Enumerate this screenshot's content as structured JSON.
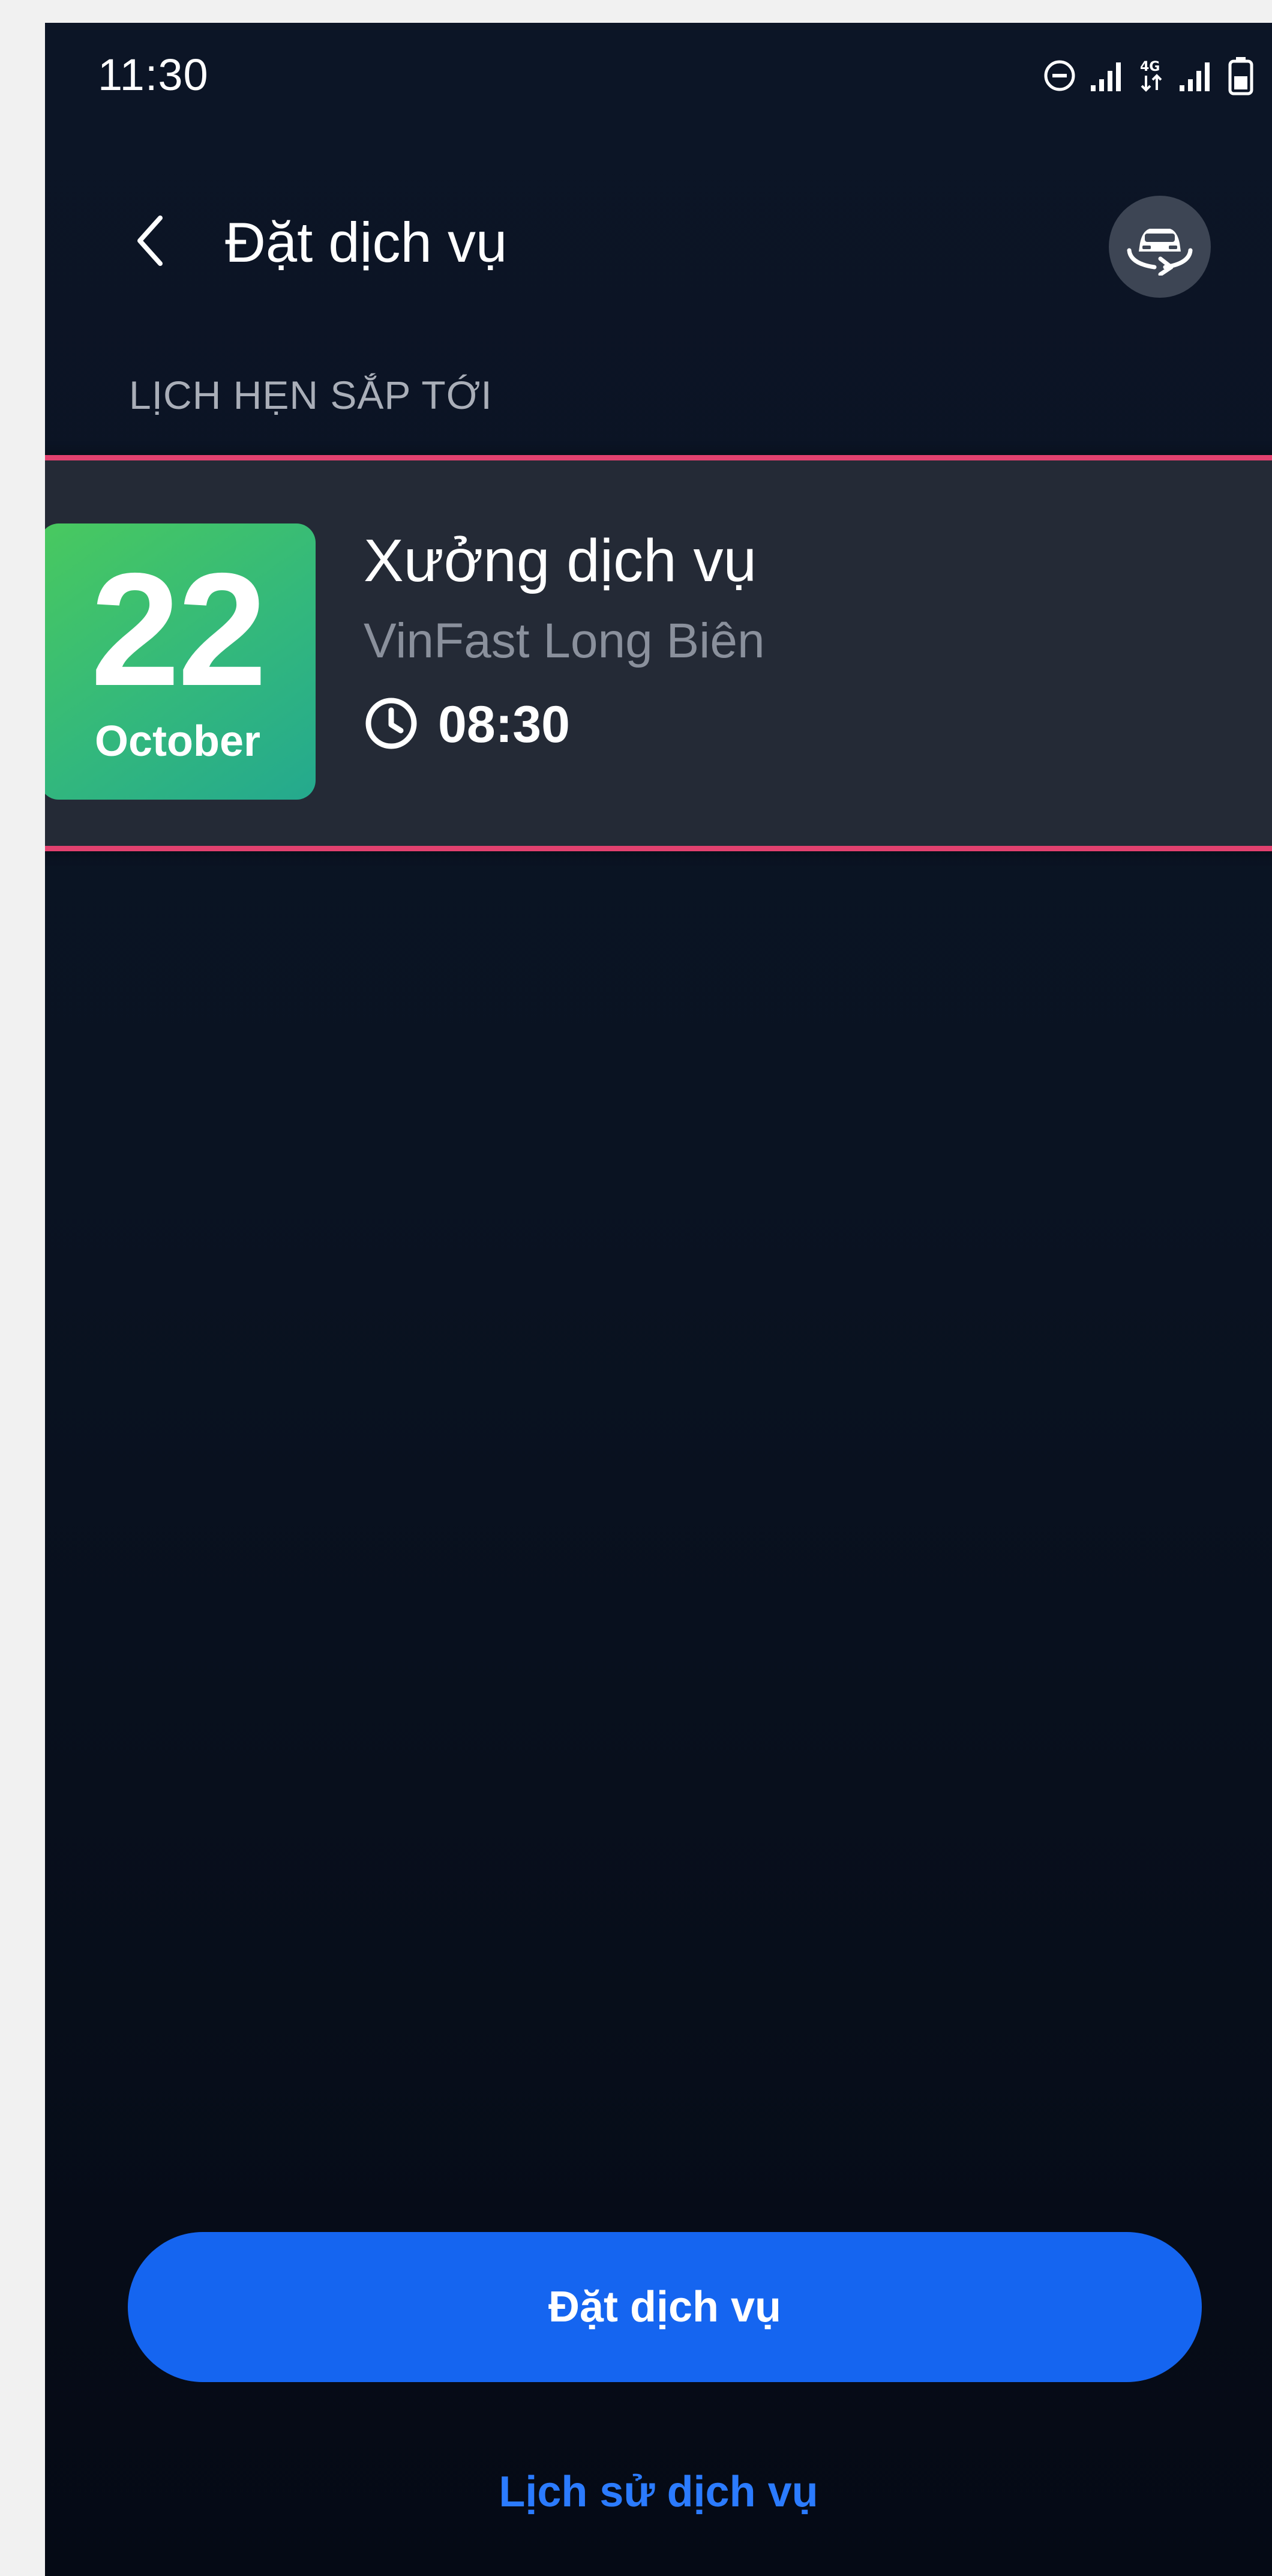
{
  "status_bar": {
    "time": "11:30",
    "icons": [
      "do-not-disturb-icon",
      "signal-icon",
      "4g-data-icon",
      "signal-icon",
      "battery-icon"
    ]
  },
  "header": {
    "title": "Đặt dịch vụ",
    "back_icon": "chevron-left-icon",
    "car_switch_icon": "car-switch-icon"
  },
  "section": {
    "upcoming_label": "LỊCH HẸN SẮP TỚI"
  },
  "appointment": {
    "day": "22",
    "month": "October",
    "title": "Xưởng dịch vụ",
    "location": "VinFast Long Biên",
    "time": "08:30",
    "time_icon": "clock-icon"
  },
  "actions": {
    "book_label": "Đặt dịch vụ",
    "history_label": "Lịch sử dịch vụ"
  },
  "colors": {
    "background": "#0a1322",
    "card": "#242a36",
    "card_highlight": "#e2416f",
    "date_tile_start": "#49c95f",
    "date_tile_end": "#24a98e",
    "primary_button": "#1565f0",
    "link": "#2b7bff",
    "muted_text": "#8a909c"
  }
}
